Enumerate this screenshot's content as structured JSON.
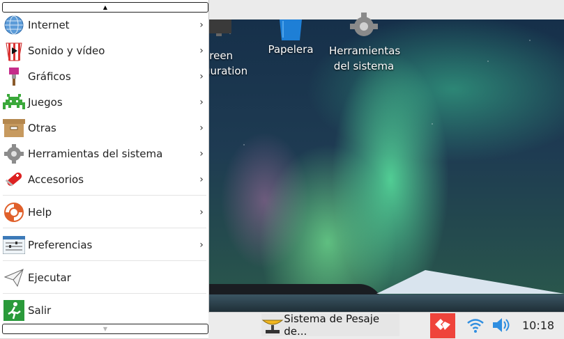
{
  "menu": {
    "items": [
      {
        "label": "Internet",
        "icon": "globe-icon",
        "has_submenu": true
      },
      {
        "label": "Sonido y vídeo",
        "icon": "popcorn-icon",
        "has_submenu": true
      },
      {
        "label": "Gráficos",
        "icon": "paintbrush-icon",
        "has_submenu": true
      },
      {
        "label": "Juegos",
        "icon": "space-invader-icon",
        "has_submenu": true
      },
      {
        "label": "Otras",
        "icon": "box-icon",
        "has_submenu": true
      },
      {
        "label": "Herramientas del sistema",
        "icon": "gear-icon",
        "has_submenu": true
      },
      {
        "label": "Accesorios",
        "icon": "swiss-knife-icon",
        "has_submenu": true
      },
      {
        "label": "Help",
        "icon": "lifebuoy-icon",
        "has_submenu": true
      },
      {
        "label": "Preferencias",
        "icon": "preferences-icon",
        "has_submenu": true
      },
      {
        "label": "Ejecutar",
        "icon": "paper-plane-icon",
        "has_submenu": false
      },
      {
        "label": "Salir",
        "icon": "exit-icon",
        "has_submenu": false
      }
    ],
    "chevron": "›",
    "scroll_up": "▲",
    "scroll_down": "▼"
  },
  "desktop": {
    "icons": [
      {
        "label_line1": "creen",
        "label_line2": "guration",
        "icon": "monitor-icon"
      },
      {
        "label_line1": "Papelera",
        "label_line2": "",
        "icon": "trash-icon"
      },
      {
        "label_line1": "Herramientas",
        "label_line2": "del sistema",
        "icon": "gear-icon"
      }
    ]
  },
  "taskbar": {
    "app_label": "Sistema de Pesaje de...",
    "app_icon": "scale-icon",
    "clock": "10:18",
    "accent": "#ef443b"
  }
}
